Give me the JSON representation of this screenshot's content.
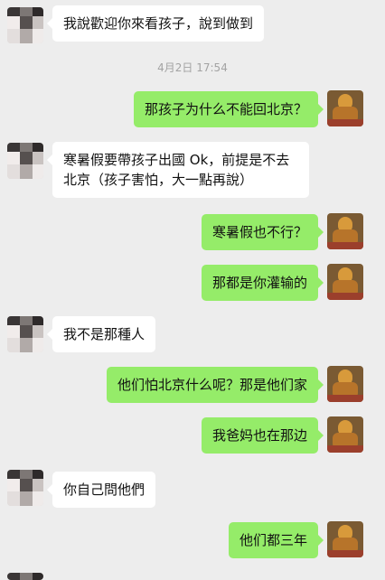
{
  "timestamp": "4月2日 17:54",
  "colors": {
    "background": "#ededed",
    "incoming_bubble": "#ffffff",
    "outgoing_bubble": "#95ec69",
    "timestamp_text": "#a3a3a3"
  },
  "messages": [
    {
      "side": "in",
      "text": "我說歡迎你來看孩子，說到做到"
    },
    {
      "side": "out",
      "text": "那孩子为什么不能回北京？"
    },
    {
      "side": "in",
      "text": "寒暑假要帶孩子出國 Ok，前提是不去北京（孩子害怕，大一點再說）"
    },
    {
      "side": "out",
      "text": "寒暑假也不行？"
    },
    {
      "side": "out",
      "text": "那都是你灌输的"
    },
    {
      "side": "in",
      "text": "我不是那種人"
    },
    {
      "side": "out",
      "text": "他们怕北京什么呢？那是他们家"
    },
    {
      "side": "out",
      "text": "我爸妈也在那边"
    },
    {
      "side": "in",
      "text": "你自己問他們"
    },
    {
      "side": "out",
      "text": "他们都三年"
    }
  ],
  "icons": {
    "incoming_avatar": "pixelated-avatar",
    "outgoing_avatar": "buddha-statue-avatar"
  }
}
